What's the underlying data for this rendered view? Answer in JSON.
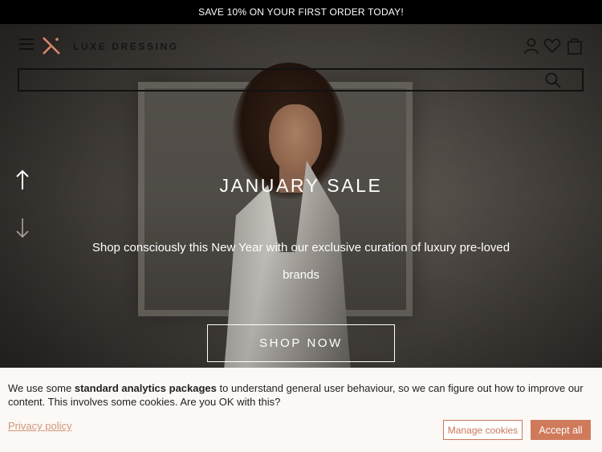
{
  "announcement": "SAVE 10% ON YOUR FIRST ORDER TODAY!",
  "brand": {
    "name": "LUXE DRESSING",
    "accent_color": "#d8896b"
  },
  "header": {
    "icons": [
      "menu-icon",
      "account-icon",
      "heart-icon",
      "bag-icon"
    ]
  },
  "search": {
    "value": "",
    "placeholder": ""
  },
  "hero": {
    "title": "JANUARY SALE",
    "subtitle": "Shop consciously this New Year with our exclusive curation of luxury pre-loved brands",
    "cta": "SHOP NOW",
    "arrows": [
      "arrow-up-icon",
      "arrow-down-icon"
    ]
  },
  "cookie_banner": {
    "text_before": "We use some ",
    "text_bold": "standard analytics packages",
    "text_after": " to understand general user behaviour, so we can figure out how to improve our content. This involves some cookies. Are you OK with this?",
    "privacy_link": "Privacy policy",
    "manage_label": "Manage cookies",
    "accept_label": "Accept all",
    "button_color": "#cf7a5b"
  }
}
